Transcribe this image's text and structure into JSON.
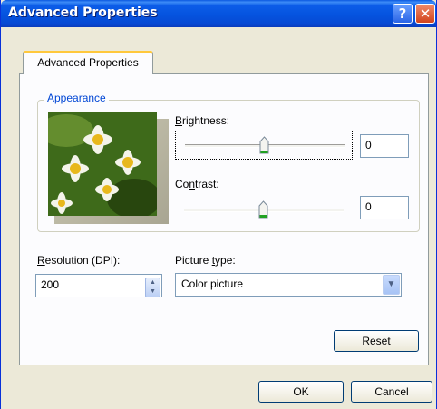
{
  "window": {
    "title": "Advanced Properties",
    "help_glyph": "?",
    "close_glyph": "✕"
  },
  "tabs": [
    {
      "label": "Advanced Properties",
      "active": true
    }
  ],
  "appearance": {
    "group_label": "Appearance",
    "preview_image": "flowers-photo",
    "brightness": {
      "label_underlined": "B",
      "label_rest": "rightness:",
      "value": "0",
      "slider_level": 0.5
    },
    "contrast": {
      "label_pre": "Co",
      "label_underlined": "n",
      "label_post": "trast:",
      "value": "0",
      "slider_level": 0.5
    }
  },
  "resolution": {
    "label_underlined": "R",
    "label_rest": "esolution (DPI):",
    "value": "200"
  },
  "picture_type": {
    "label_pre": "Picture ",
    "label_underlined": "t",
    "label_post": "ype:",
    "value": "Color picture"
  },
  "buttons": {
    "reset": {
      "pre": "R",
      "underlined": "e",
      "post": "set"
    },
    "ok": "OK",
    "cancel": "Cancel"
  },
  "colors": {
    "titlebar": "#0553df",
    "face": "#ece9d8",
    "group_label": "#0046d5"
  }
}
